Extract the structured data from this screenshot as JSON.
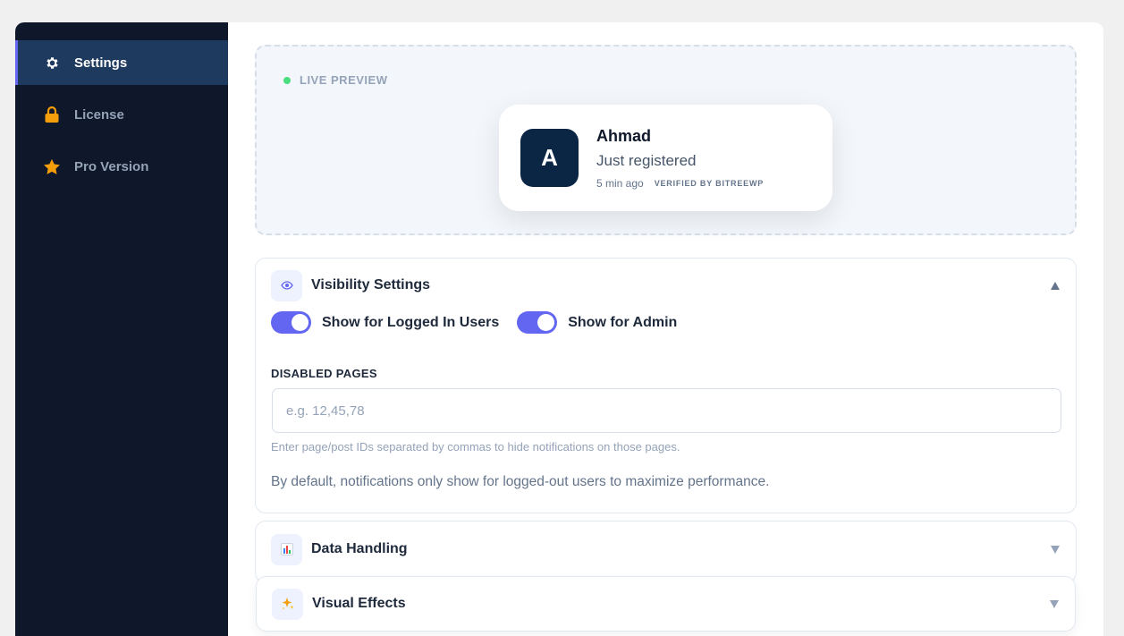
{
  "sidebar": {
    "items": [
      {
        "label": "Settings",
        "icon": "gear-icon",
        "active": true
      },
      {
        "label": "License",
        "icon": "lock-icon",
        "active": false
      },
      {
        "label": "Pro Version",
        "icon": "star-icon",
        "active": false
      }
    ]
  },
  "preview": {
    "badge": "LIVE PREVIEW",
    "notification": {
      "avatar_letter": "A",
      "name": "Ahmad",
      "action": "Just registered",
      "time": "5 min ago",
      "verified": "VERIFIED BY BITREEWP"
    }
  },
  "visibility": {
    "title": "Visibility Settings",
    "icon": "eye-icon",
    "expanded": true,
    "toggles": [
      {
        "label": "Show for Logged In Users",
        "on": true
      },
      {
        "label": "Show for Admin",
        "on": true
      }
    ],
    "disabled_pages": {
      "label": "DISABLED PAGES",
      "value": "",
      "placeholder": "e.g. 12,45,78",
      "help": "Enter page/post IDs separated by commas to hide notifications on those pages."
    },
    "info": "By default, notifications only show for logged-out users to maximize performance."
  },
  "data_handling": {
    "title": "Data Handling",
    "icon": "bar-chart-icon",
    "expanded": false
  },
  "visual_effects": {
    "title": "Visual Effects",
    "icon": "sparkles-icon",
    "expanded": false
  },
  "colors": {
    "sidebar_bg": "#0f172a",
    "sidebar_active": "#1e3a5f",
    "accent": "#6366f1",
    "avatar_bg": "#0b2545",
    "live_dot": "#4ade80",
    "icon_orange": "#f59e0b"
  }
}
